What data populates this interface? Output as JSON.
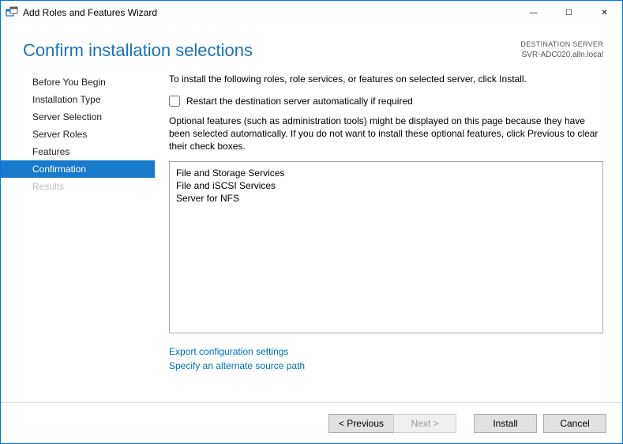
{
  "window": {
    "title": "Add Roles and Features Wizard",
    "min": "—",
    "max": "☐",
    "close": "✕"
  },
  "page": {
    "title": "Confirm installation selections"
  },
  "destination": {
    "label": "DESTINATION SERVER",
    "server": "SVR-ADC020.alln.local"
  },
  "sidebar": {
    "items": [
      {
        "label": "Before You Begin"
      },
      {
        "label": "Installation Type"
      },
      {
        "label": "Server Selection"
      },
      {
        "label": "Server Roles"
      },
      {
        "label": "Features"
      },
      {
        "label": "Confirmation"
      },
      {
        "label": "Results"
      }
    ]
  },
  "content": {
    "intro": "To install the following roles, role services, or features on selected server, click Install.",
    "restart_checkbox_label": "Restart the destination server automatically if required",
    "restart_checked": false,
    "optional_text": "Optional features (such as administration tools) might be displayed on this page because they have been selected automatically. If you do not want to install these optional features, click Previous to clear their check boxes.",
    "tree": [
      {
        "indent": 1,
        "label": "File and Storage Services"
      },
      {
        "indent": 2,
        "label": "File and iSCSI Services"
      },
      {
        "indent": 3,
        "label": "Server for NFS"
      }
    ],
    "links": {
      "export": "Export configuration settings",
      "alt_source": "Specify an alternate source path"
    }
  },
  "footer": {
    "previous": "< Previous",
    "next": "Next >",
    "install": "Install",
    "cancel": "Cancel"
  }
}
